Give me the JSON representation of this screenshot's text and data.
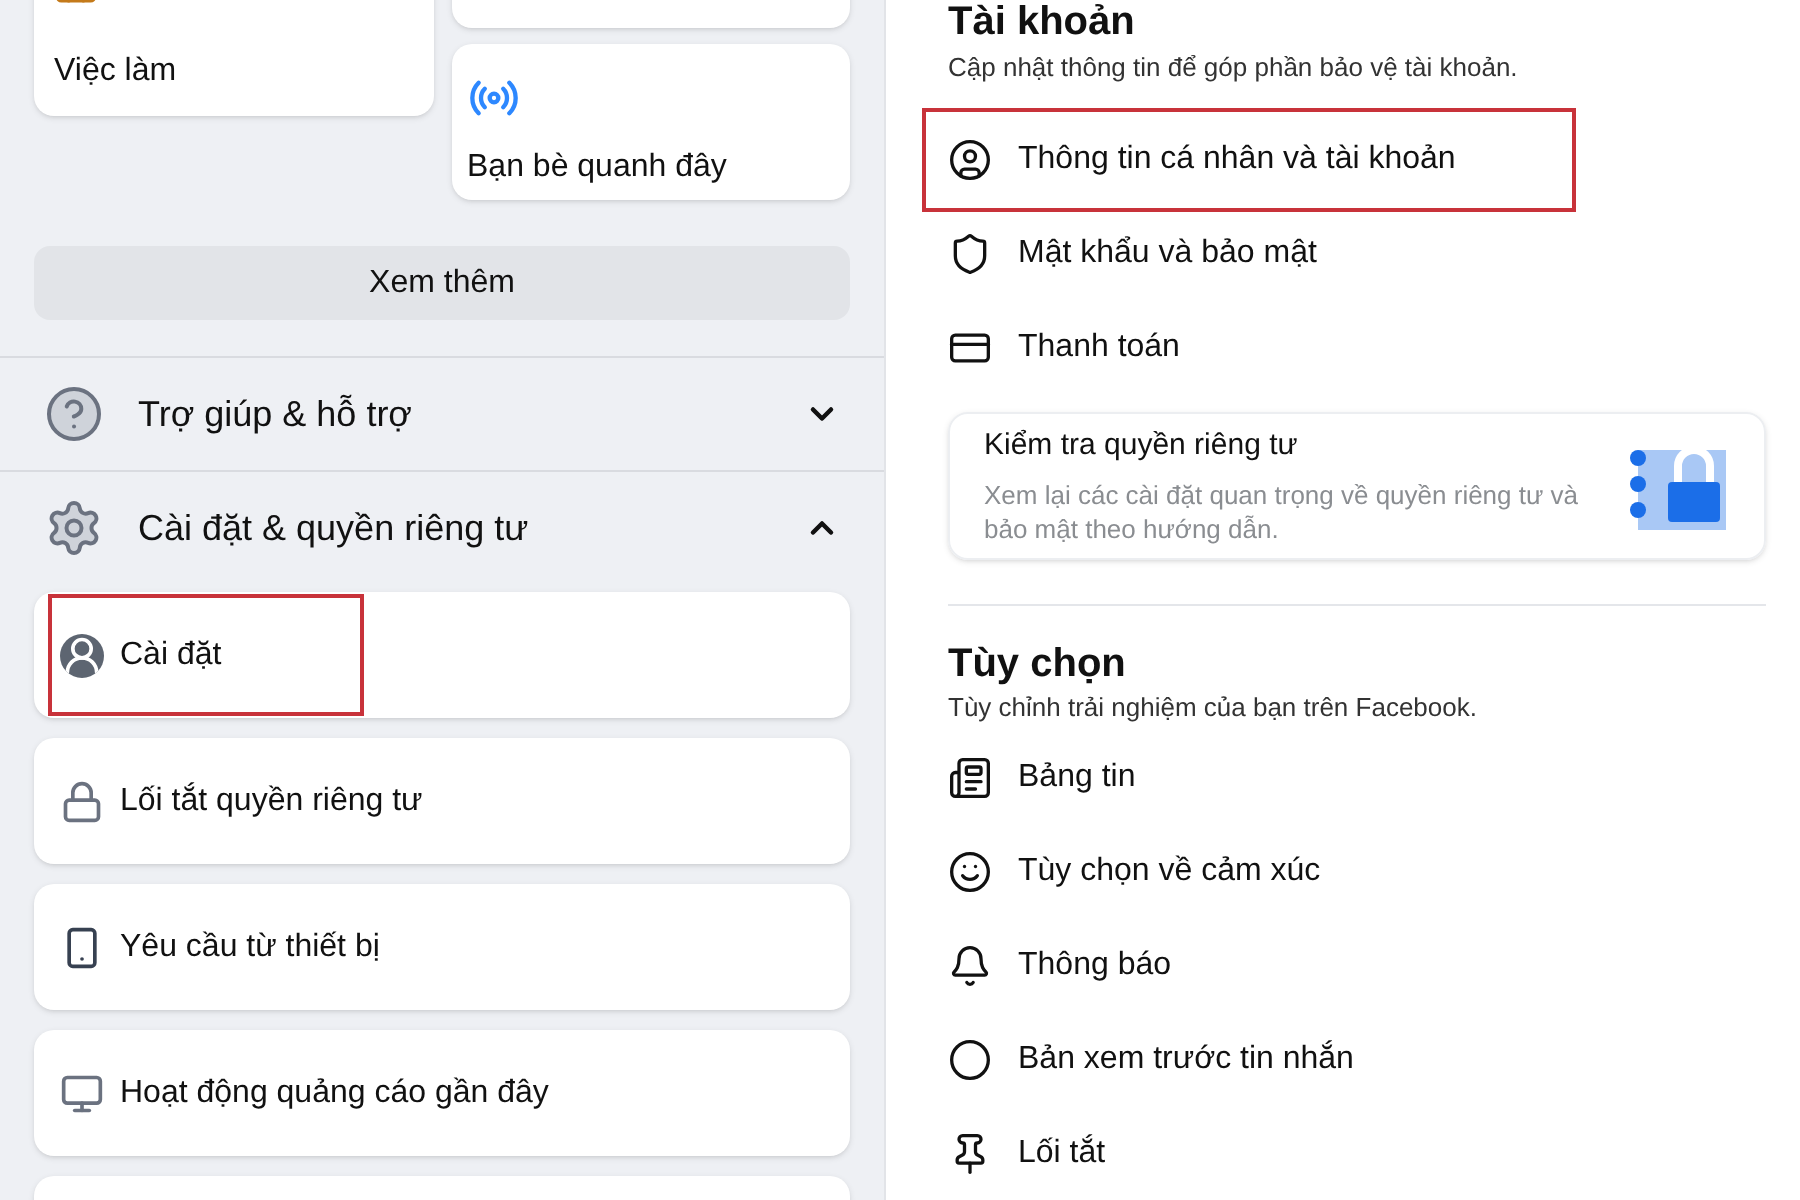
{
  "left": {
    "shortcut_cards": [
      {
        "label": "Việc làm"
      },
      {
        "label": "Bạn bè quanh đây"
      }
    ],
    "more_button": "Xem thêm",
    "sections": [
      {
        "label": "Trợ giúp & hỗ trợ",
        "expanded": false
      },
      {
        "label": "Cài đặt & quyền riêng tư",
        "expanded": true,
        "items": [
          {
            "label": "Cài đặt",
            "highlighted": true
          },
          {
            "label": "Lối tắt quyền riêng tư",
            "highlighted": false
          },
          {
            "label": "Yêu cầu từ thiết bị",
            "highlighted": false
          },
          {
            "label": "Hoạt động quảng cáo gần đây",
            "highlighted": false
          }
        ]
      }
    ]
  },
  "right": {
    "account": {
      "title": "Tài khoản",
      "subtitle": "Cập nhật thông tin để góp phần bảo vệ tài khoản.",
      "items": [
        {
          "label": "Thông tin cá nhân và tài khoản",
          "highlighted": true
        },
        {
          "label": "Mật khẩu và bảo mật",
          "highlighted": false
        },
        {
          "label": "Thanh toán",
          "highlighted": false
        }
      ],
      "privacy_card": {
        "title": "Kiểm tra quyền riêng tư",
        "text": "Xem lại các cài đặt quan trọng về quyền riêng tư và bảo mật theo hướng dẫn."
      }
    },
    "preferences": {
      "title": "Tùy chọn",
      "subtitle": "Tùy chỉnh trải nghiệm của bạn trên Facebook.",
      "items": [
        {
          "label": "Bảng tin",
          "highlighted": false
        },
        {
          "label": "Tùy chọn về cảm xúc",
          "highlighted": false
        },
        {
          "label": "Thông báo",
          "highlighted": false
        },
        {
          "label": "Bản xem trước tin nhắn",
          "highlighted": false
        },
        {
          "label": "Lối tắt",
          "highlighted": false
        }
      ]
    }
  }
}
